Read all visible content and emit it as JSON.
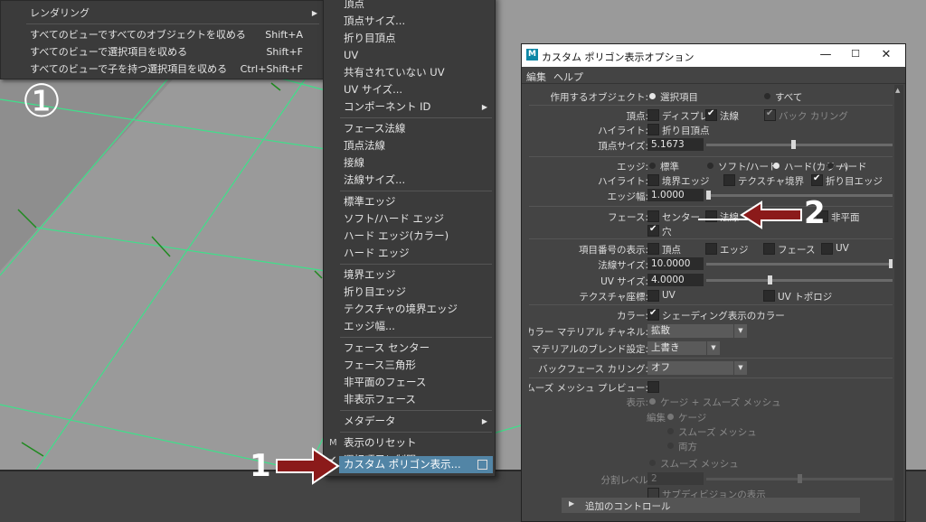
{
  "left_menu": {
    "items": [
      {
        "label": "レンダリング",
        "shortcut": "",
        "submenu": true
      },
      {
        "label": "すべてのビューですべてのオブジェクトを収める",
        "shortcut": "Shift+A"
      },
      {
        "label": "すべてのビューで選択項目を収める",
        "shortcut": "Shift+F"
      },
      {
        "label": "すべてのビューで子を持つ選択項目を収める",
        "shortcut": "Ctrl+Shift+F"
      }
    ]
  },
  "callouts": {
    "circle": "①",
    "one": "1",
    "two": "2"
  },
  "main_menu": {
    "items": [
      {
        "label": "頂点"
      },
      {
        "label": "頂点サイズ..."
      },
      {
        "label": "折り目頂点"
      },
      {
        "label": "UV"
      },
      {
        "label": "共有されていない UV"
      },
      {
        "label": "UV サイズ..."
      },
      {
        "label": "コンポーネント ID",
        "submenu": true
      },
      {
        "label": "フェース法線"
      },
      {
        "label": "頂点法線"
      },
      {
        "label": "接線"
      },
      {
        "label": "法線サイズ..."
      },
      {
        "label": "標準エッジ"
      },
      {
        "label": "ソフト/ハード エッジ"
      },
      {
        "label": "ハード エッジ(カラー)"
      },
      {
        "label": "ハード エッジ"
      },
      {
        "label": "境界エッジ"
      },
      {
        "label": "折り目エッジ"
      },
      {
        "label": "テクスチャの境界エッジ"
      },
      {
        "label": "エッジ幅..."
      },
      {
        "label": "フェース センター"
      },
      {
        "label": "フェース三角形"
      },
      {
        "label": "非平面のフェース"
      },
      {
        "label": "非表示フェース"
      },
      {
        "label": "メタデータ",
        "submenu": true
      },
      {
        "label": "表示のリセット",
        "icon": "M"
      },
      {
        "label": "選択項目に制限",
        "icon": "✔"
      },
      {
        "label": "カスタム ポリゴン表示...",
        "highlighted": true
      }
    ]
  },
  "dialog": {
    "title": "カスタム ポリゴン表示オプション",
    "icon_letter": "M",
    "window_buttons": {
      "minimize": "—",
      "maximize": "☐",
      "close": "✕"
    },
    "menus": [
      "編集",
      "ヘルプ"
    ],
    "apply_to": {
      "label": "作用するオブジェクト:",
      "options": [
        "選択項目",
        "すべて"
      ],
      "selected": 0
    },
    "vertices": {
      "label": "頂点:",
      "options": [
        {
          "label": "ディスプレイ",
          "checked": false
        },
        {
          "label": "法線",
          "checked": true
        },
        {
          "label": "バック カリング",
          "checked": true,
          "disabled": true
        }
      ]
    },
    "vertex_highlight": {
      "label": "ハイライト:",
      "option": {
        "label": "折り目頂点",
        "checked": false
      }
    },
    "vertex_size": {
      "label": "頂点サイズ:",
      "value": "5.1673",
      "slider_fraction": 0.46
    },
    "edges": {
      "label": "エッジ:",
      "options": [
        "標準",
        "ソフト/ハード",
        "ハード(カラー)",
        "ハード"
      ],
      "selected": 2
    },
    "edge_highlight": {
      "label": "ハイライト:",
      "options": [
        {
          "label": "境界エッジ",
          "checked": false
        },
        {
          "label": "テクスチャ境界",
          "checked": false
        },
        {
          "label": "折り目エッジ",
          "checked": true
        }
      ]
    },
    "edge_width": {
      "label": "エッジ幅:",
      "value": "1.0000",
      "slider_fraction": 0.0
    },
    "faces": {
      "label": "フェース:",
      "options": [
        {
          "label": "センター",
          "checked": false
        },
        {
          "label": "法線",
          "checked": false
        },
        {
          "label": "非平面",
          "checked": false
        },
        {
          "label": "穴",
          "checked": true
        }
      ]
    },
    "item_numbers": {
      "label": "項目番号の表示:",
      "options": [
        {
          "label": "頂点",
          "checked": false
        },
        {
          "label": "エッジ",
          "checked": false
        },
        {
          "label": "フェース",
          "checked": false
        },
        {
          "label": "UV",
          "checked": false
        }
      ]
    },
    "normal_size": {
      "label": "法線サイズ:",
      "value": "10.0000",
      "slider_fraction": 1.0
    },
    "uv_size": {
      "label": "UV サイズ:",
      "value": "4.0000",
      "slider_fraction": 0.34
    },
    "texture_coords": {
      "label": "テクスチャ座標:",
      "options": [
        {
          "label": "UV",
          "checked": false
        },
        {
          "label": "UV トポロジ",
          "checked": false
        }
      ]
    },
    "color": {
      "label": "カラー:",
      "option": {
        "label": "シェーディング表示のカラー",
        "checked": true
      }
    },
    "color_material_channel": {
      "label": "カラー マテリアル チャネル:",
      "value": "拡散"
    },
    "material_blend": {
      "label": "マテリアルのブレンド設定:",
      "value": "上書き"
    },
    "backface_culling": {
      "label": "バックフェース カリング:",
      "value": "オフ"
    },
    "smooth_preview": {
      "label": "スムーズ メッシュ プレビュー:",
      "checked": false
    },
    "display": {
      "label": "表示:",
      "option": "ケージ + スムーズ メッシュ"
    },
    "edit": {
      "label": "編集",
      "options": [
        "ケージ",
        "スムーズ メッシュ",
        "両方"
      ]
    },
    "smooth_mesh_option": "スムーズ メッシュ",
    "division_level": {
      "label": "分割レベル",
      "value": "2",
      "slider_fraction": 0.6
    },
    "subdivision_display": {
      "label": "サブディビジョンの表示",
      "checked": false
    },
    "additional_controls": "追加のコントロール"
  },
  "colors": {
    "viewport": "#8e8e8e",
    "wireframe": "#3ee08a",
    "highlight": "#5285a6",
    "arrow": "#8b1a1a"
  }
}
